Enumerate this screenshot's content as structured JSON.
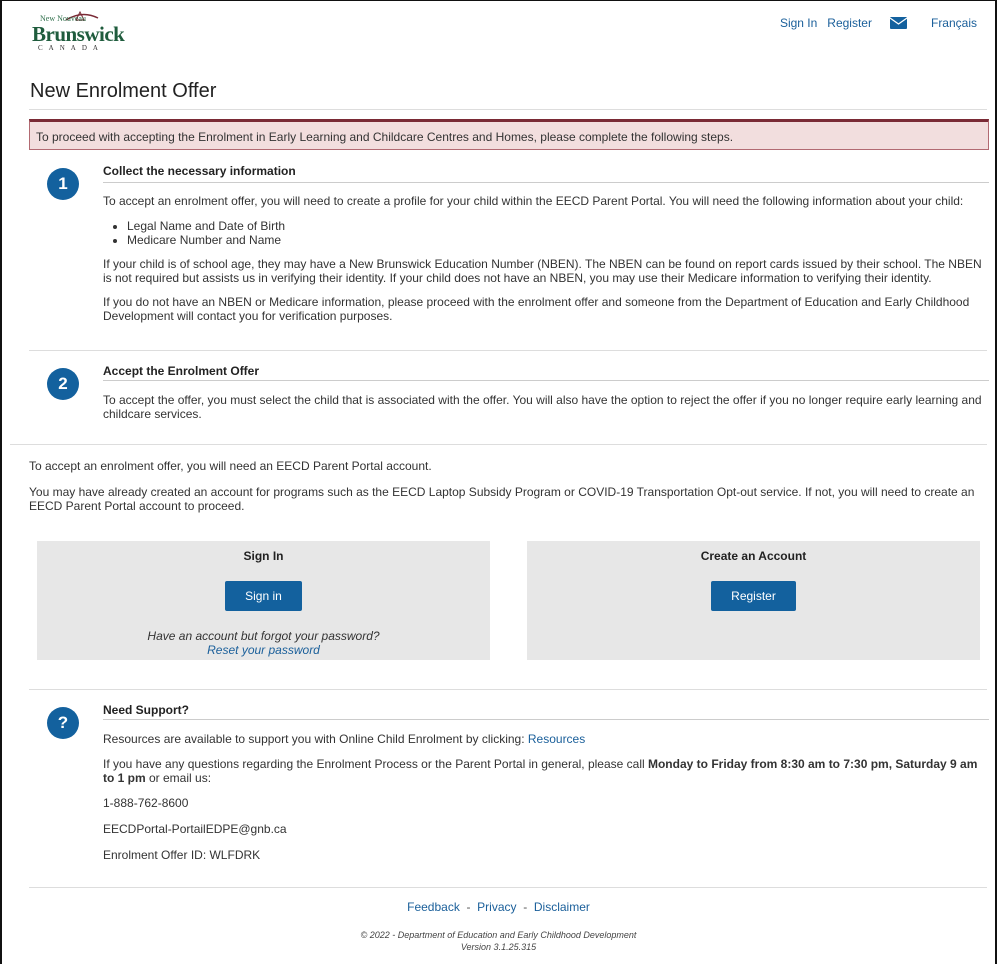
{
  "logo": {
    "top": "New  Nouveau",
    "name": "Brunswick",
    "country": "CANADA"
  },
  "topnav": {
    "sign_in": "Sign In",
    "register": "Register",
    "language": "Français"
  },
  "page_title": "New Enrolment Offer",
  "alert_text": "To proceed with accepting the Enrolment in Early Learning and Childcare Centres and Homes, please complete the following steps.",
  "step1": {
    "number": "1",
    "title": "Collect the necessary information",
    "p1": "To accept an enrolment offer, you will need to create a profile for your child within the EECD Parent Portal. You will need the following information about your child:",
    "items": [
      "Legal Name and Date of Birth",
      "Medicare Number and Name"
    ],
    "p2": "If your child is of school age, they may have a New Brunswick Education Number (NBEN). The NBEN can be found on report cards issued by their school. The NBEN is not required but assists us in verifying their identity. If your child does not have an NBEN, you may use their Medicare information to verifying their identity.",
    "p3": "If you do not have an NBEN or Medicare information, please proceed with the enrolment offer and someone from the Department of Education and Early Childhood Development will contact you for verification purposes."
  },
  "step2": {
    "number": "2",
    "title": "Accept the Enrolment Offer",
    "p1": "To accept the offer, you must select the child that is associated with the offer. You will also have the option to reject the offer if you no longer require early learning and childcare services."
  },
  "account_intro1": "To accept an enrolment offer, you will need an EECD Parent Portal account.",
  "account_intro2": "You may have already created an account for programs such as the EECD Laptop Subsidy Program or COVID-19 Transportation Opt-out service. If not, you will need to create an EECD Parent Portal account to proceed.",
  "signin_box": {
    "title": "Sign In",
    "button": "Sign in",
    "forgot": "Have an account but forgot your password?",
    "reset": "Reset your password"
  },
  "create_box": {
    "title": "Create an Account",
    "button": "Register"
  },
  "support": {
    "icon": "?",
    "title": "Need Support?",
    "resources_text": "Resources are available to support you with Online Child Enrolment by clicking: ",
    "resources_link": "Resources",
    "hours_pre": "If you have any questions regarding the Enrolment Process or the Parent Portal in general, please call ",
    "hours_bold": "Monday to Friday from 8:30 am to 7:30 pm, Saturday 9 am to 1 pm",
    "hours_post": " or email us:",
    "phone": "1-888-762-8600",
    "email": "EECDPortal-PortailEDPE@gnb.ca",
    "offer_id": "Enrolment Offer ID: WLFDRK"
  },
  "footer": {
    "feedback": "Feedback",
    "privacy": "Privacy",
    "disclaimer": "Disclaimer",
    "sep": "-",
    "copyright": "© 2022 - Department of Education and Early Childhood Development",
    "version": "Version 3.1.25.315"
  },
  "colors": {
    "primary": "#13619e",
    "link": "#1a5f9a",
    "alert_bg": "#f2dede",
    "alert_border": "#7a2a35",
    "panel_bg": "#e7e7e7"
  }
}
